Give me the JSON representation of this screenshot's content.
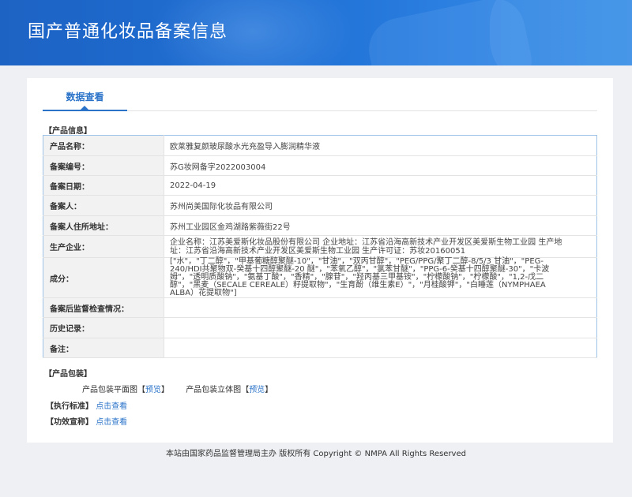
{
  "header": {
    "title": "国产普通化妆品备案信息"
  },
  "tabs": [
    {
      "label": "数据查看"
    }
  ],
  "product_info": {
    "section_title": "【产品信息】",
    "rows": [
      {
        "label": "产品名称：",
        "value": "欧莱雅复颜玻尿酸水光充盈导入膨润精华液"
      },
      {
        "label": "备案编号：",
        "value": "苏G妆网备字2022003004"
      },
      {
        "label": "备案日期：",
        "value": "2022-04-19"
      },
      {
        "label": "备案人：",
        "value": "苏州尚美国际化妆品有限公司"
      },
      {
        "label": "备案人住所地址：",
        "value": "苏州工业园区金鸡湖路紫薇街22号"
      },
      {
        "label": "生产企业：",
        "value": "企业名称：江苏美爱斯化妆品股份有限公司 企业地址：江苏省沿海高新技术产业开发区美爱斯生物工业园 生产地址：江苏省沿海高新技术产业开发区美爱斯生物工业园 生产许可证：苏妆20160051"
      },
      {
        "label": "成分：",
        "value": "[\"水\"，\"丁二醇\"，\"甲基葡糖醇聚醚-10\"，\"甘油\"，\"双丙甘醇\"，\"PEG/PPG/聚丁二醇-8/5/3 甘油\"，\"PEG-240/HDI共聚物双-癸基十四醇聚醚-20 醚\"，\"苯氧乙醇\"，\"氯苯甘醚\"，\"PPG-6-癸基十四醇聚醚-30\"，\"卡波姆\"，\"透明质酸钠\"，\"氨基丁酸\"，\"香精\"，\"腺苷\"，\"羟丙基三甲基铵\"，\"柠檬酸钠\"，\"柠檬酸\"，\"1,2-戊二醇\"，\"黑麦（SECALE CEREALE）籽提取物\"，\"生育酚（维生素E）\"，\"月桂酸钾\"，\"白睡莲（NYMPHAEA ALBA）花提取物\"]"
      },
      {
        "label": "备案后监督检查情况：",
        "value": ""
      },
      {
        "label": "历史记录：",
        "value": ""
      },
      {
        "label": "备注：",
        "value": ""
      }
    ]
  },
  "packaging": {
    "section_title": "【产品包装】",
    "items": [
      {
        "label": "产品包装平面图",
        "link": "预览"
      },
      {
        "label": "产品包装立体图",
        "link": "预览"
      }
    ]
  },
  "standard": {
    "label": "【执行标准】",
    "link": "点击查看"
  },
  "claims": {
    "label": "【功效宣称】",
    "link": "点击查看"
  },
  "footer": {
    "text": "本站由国家药品监督管理局主办 版权所有 Copyright © NMPA All Rights Reserved"
  }
}
